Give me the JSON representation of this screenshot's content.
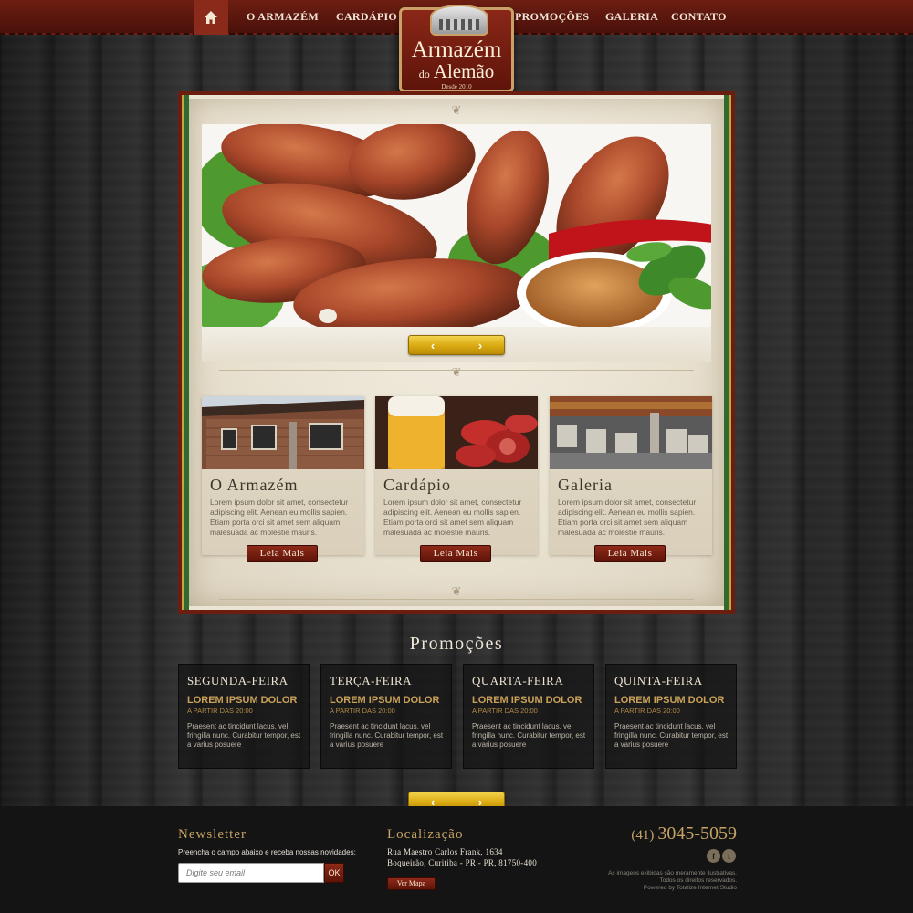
{
  "nav": {
    "home_icon": "home-icon",
    "items": [
      "O Armazém",
      "Cardápio",
      "Promoções",
      "Galeria",
      "Contato"
    ]
  },
  "logo": {
    "line1": "Armazém",
    "line2_small": "do",
    "line2_big": "Alemão",
    "since": "Desde 2010"
  },
  "slider": {
    "prev_label": "‹",
    "next_label": "›"
  },
  "cards": [
    {
      "title": "O Armazém",
      "text": "Lorem ipsum dolor sit amet, consectetur adipiscing elit. Aenean eu mollis sapien. Etiam porta orci sit amet sem aliquam malesuada ac molestie mauris.",
      "button": "Leia Mais"
    },
    {
      "title": "Cardápio",
      "text": "Lorem ipsum dolor sit amet, consectetur adipiscing elit. Aenean eu mollis sapien. Etiam porta orci sit amet sem aliquam malesuada ac molestie mauris.",
      "button": "Leia Mais"
    },
    {
      "title": "Galeria",
      "text": "Lorem ipsum dolor sit amet, consectetur adipiscing elit. Aenean eu mollis sapien. Etiam porta orci sit amet sem aliquam malesuada ac molestie mauris.",
      "button": "Leia Mais"
    }
  ],
  "promos": {
    "heading": "Promoções",
    "items": [
      {
        "day": "Segunda-feira",
        "title": "Lorem ipsum dolor",
        "sub": "A partir das 20:00",
        "text": "Praesent ac tincidunt lacus, vel fringilla nunc. Curabitur tempor, est a varius posuere"
      },
      {
        "day": "Terça-feira",
        "title": "Lorem ipsum dolor",
        "sub": "A partir das 20:00",
        "text": "Praesent ac tincidunt lacus, vel fringilla nunc. Curabitur tempor, est a varius posuere"
      },
      {
        "day": "Quarta-feira",
        "title": "Lorem ipsum dolor",
        "sub": "A partir das 20:00",
        "text": "Praesent ac tincidunt lacus, vel fringilla nunc. Curabitur tempor, est a varius posuere"
      },
      {
        "day": "Quinta-feira",
        "title": "Lorem ipsum dolor",
        "sub": "A partir das 20:00",
        "text": "Praesent ac tincidunt lacus, vel fringilla nunc. Curabitur tempor, est a varius posuere"
      }
    ]
  },
  "footer": {
    "newsletter_title": "Newsletter",
    "newsletter_text": "Preencha o campo abaixo e receba nossas novidades:",
    "email_placeholder": "Digite seu email",
    "ok_label": "OK",
    "location_title": "Localização",
    "address1": "Rua Maestro Carlos Frank, 1634",
    "address2": "Boqueirão, Curitiba - PR - PR, 81750-400",
    "map_button": "Ver Mapa",
    "phone_ddd": "(41)",
    "phone_number": "3045-5059",
    "social": [
      {
        "icon": "facebook-icon",
        "glyph": "f"
      },
      {
        "icon": "twitter-icon",
        "glyph": "t"
      }
    ],
    "legal1": "As imagens exibidas são meramente ilustrativas.",
    "legal2": "Todos os direitos reservados.",
    "legal3": "Powered by Totalize Internet Studio"
  },
  "colors": {
    "nav_red": "#5e140a",
    "gold": "#c7a464",
    "button_red": "#7a1f10",
    "slider_gold": "#d9a911"
  }
}
